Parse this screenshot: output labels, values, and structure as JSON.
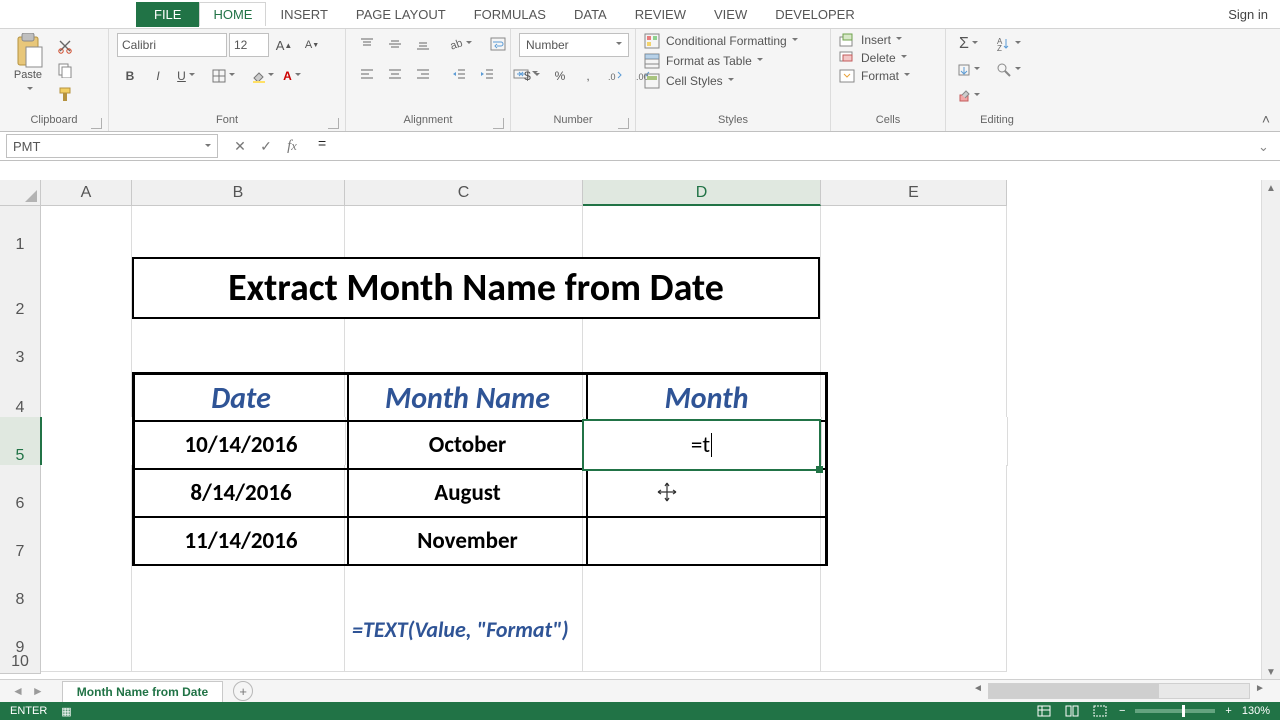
{
  "tabs": {
    "file": "FILE",
    "home": "HOME",
    "insert": "INSERT",
    "pagelayout": "PAGE LAYOUT",
    "formulas": "FORMULAS",
    "data": "DATA",
    "review": "REVIEW",
    "view": "VIEW",
    "developer": "DEVELOPER"
  },
  "signin": "Sign in",
  "ribbon_groups": {
    "clipboard": "Clipboard",
    "font": "Font",
    "alignment": "Alignment",
    "number": "Number",
    "styles": "Styles",
    "cells": "Cells",
    "editing": "Editing"
  },
  "clipboard": {
    "paste": "Paste"
  },
  "font": {
    "name": "Calibri",
    "size": "12",
    "bold": "B",
    "italic": "I",
    "underline": "U"
  },
  "number": {
    "format": "Number",
    "currency": "$",
    "percent": "%",
    "comma": ",",
    "inc": "",
    "dec": ""
  },
  "styles": {
    "cond": "Conditional Formatting",
    "table": "Format as Table",
    "cell": "Cell Styles"
  },
  "cells": {
    "insert": "Insert",
    "delete": "Delete",
    "format": "Format"
  },
  "namebox": "PMT",
  "formula": "=",
  "columns": [
    "A",
    "B",
    "C",
    "D",
    "E"
  ],
  "rownums": [
    "1",
    "2",
    "3",
    "4",
    "5",
    "6",
    "7",
    "8",
    "9",
    "10"
  ],
  "title": "Extract Month Name from Date",
  "headers": {
    "date": "Date",
    "monthname": "Month Name",
    "month": "Month"
  },
  "data": [
    {
      "date": "10/14/2016",
      "monthname": "October",
      "month": "=t"
    },
    {
      "date": "8/14/2016",
      "monthname": "August",
      "month": ""
    },
    {
      "date": "11/14/2016",
      "monthname": "November",
      "month": ""
    }
  ],
  "editing_value": "=t",
  "hint": "=TEXT(Value, \"Format\")",
  "sheet": {
    "name": "Month Name from Date"
  },
  "status": {
    "mode": "ENTER",
    "zoom": "130%"
  },
  "chart_data": {
    "type": "table",
    "title": "Extract Month Name from Date",
    "columns": [
      "Date",
      "Month Name",
      "Month"
    ],
    "rows": [
      [
        "10/14/2016",
        "October",
        "=t"
      ],
      [
        "8/14/2016",
        "August",
        ""
      ],
      [
        "11/14/2016",
        "November",
        ""
      ]
    ],
    "formula_hint": "=TEXT(Value, \"Format\")"
  }
}
